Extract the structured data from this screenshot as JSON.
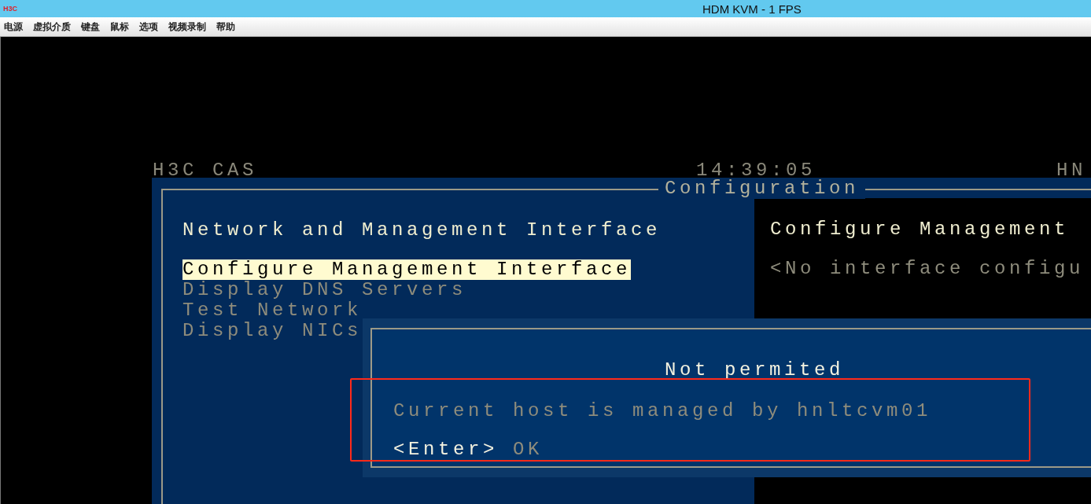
{
  "window": {
    "logo": "H3C",
    "title": "HDM KVM  - 1 FPS"
  },
  "menu": [
    "电源",
    "虚拟介质",
    "键盘",
    "鼠标",
    "选项",
    "视频录制",
    "帮助"
  ],
  "console": {
    "header": {
      "left": "H3C CAS",
      "time": "14:39:05",
      "right": "HN"
    },
    "panel_title": "Configuration",
    "menu_heading": "Network and Management Interface",
    "menu_items": [
      {
        "label": "Configure Management Interface",
        "selected": true
      },
      {
        "label": "Display DNS Servers",
        "selected": false
      },
      {
        "label": "Test Network",
        "selected": false
      },
      {
        "label": "Display NICs",
        "selected": false
      }
    ],
    "detail": {
      "title": "Configure Management",
      "message": "<No interface configu"
    },
    "dialog": {
      "title": "Not permited",
      "message": "Current host is managed by hnltcvm01",
      "key": "<Enter>",
      "action": "OK"
    }
  }
}
